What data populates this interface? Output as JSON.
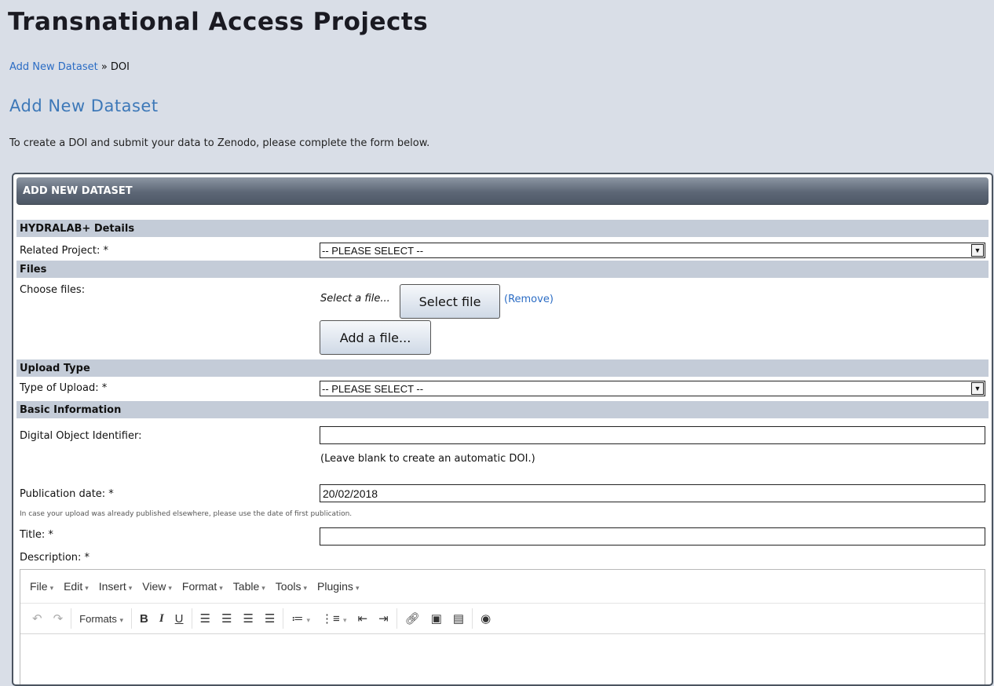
{
  "page": {
    "title": "Transnational Access Projects"
  },
  "breadcrumb": {
    "link": "Add New Dataset",
    "sep": " » ",
    "current": "DOI"
  },
  "heading": "Add New Dataset",
  "intro": "To create a DOI and submit your data to Zenodo, please complete the form below.",
  "form": {
    "header": "ADD NEW DATASET",
    "sections": {
      "details": "HYDRALAB+ Details",
      "files": "Files",
      "upload_type": "Upload Type",
      "basic": "Basic Information"
    },
    "related_project": {
      "label": "Related Project: *",
      "value": "-- PLEASE SELECT --"
    },
    "choose_files": {
      "label": "Choose files:",
      "placeholder": "Select a file...",
      "select_button": "Select file",
      "remove_link": "(Remove)",
      "add_button": "Add a file..."
    },
    "type_of_upload": {
      "label": "Type of Upload: *",
      "value": "-- PLEASE SELECT --"
    },
    "doi": {
      "label": "Digital Object Identifier:",
      "value": "",
      "hint": "(Leave blank to create an automatic DOI.)"
    },
    "publication_date": {
      "label": "Publication date: *",
      "value": "20/02/2018",
      "hint": "In case your upload was already published elsewhere, please use the date of first publication."
    },
    "title": {
      "label": "Title: *",
      "value": ""
    },
    "description": {
      "label": "Description: *"
    }
  },
  "editor": {
    "menus": [
      "File",
      "Edit",
      "Insert",
      "View",
      "Format",
      "Table",
      "Tools",
      "Plugins"
    ],
    "formats_label": "Formats",
    "icons": [
      "undo-icon",
      "redo-icon",
      "bold-icon",
      "italic-icon",
      "underline-icon",
      "align-left-icon",
      "align-center-icon",
      "align-right-icon",
      "align-justify-icon",
      "bullet-list-icon",
      "numbered-list-icon",
      "outdent-icon",
      "indent-icon",
      "link-icon",
      "image-icon",
      "media-icon",
      "preview-icon"
    ]
  }
}
